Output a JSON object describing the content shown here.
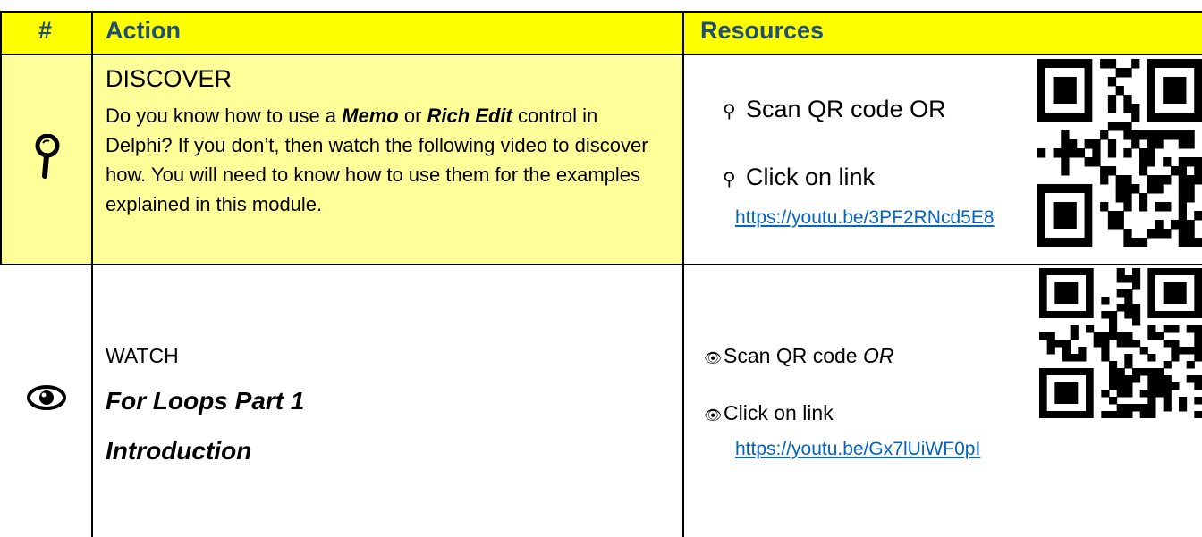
{
  "header": {
    "num": "#",
    "action": "Action",
    "resources": "Resources"
  },
  "rows": [
    {
      "icon": "magnifier-icon",
      "title": "DISCOVER",
      "text_before": "Do you know how to use a ",
      "memo": "Memo",
      "or": " or ",
      "rich": "Rich Edit",
      "text_after": " control in Delphi? If you don’t, then watch the following video to discover how. You will need to know how to use them for the examples explained in this module.",
      "res1": "Scan QR code OR",
      "res2": "Click on link",
      "link": "https://youtu.be/3PF2RNcd5E8"
    },
    {
      "icon": "eye-icon",
      "title": "WATCH",
      "subtitle1": "For Loops Part 1",
      "subtitle2": "Introduction",
      "res1_a": "Scan QR code ",
      "res1_b": "OR",
      "res2": "Click on link",
      "link": "https://youtu.be/Gx7lUiWF0pI"
    }
  ],
  "colors": {
    "header_bg": "#ffff00",
    "row_bg": "#ffff99",
    "header_text": "#1f4e79",
    "link": "#0563c1"
  }
}
